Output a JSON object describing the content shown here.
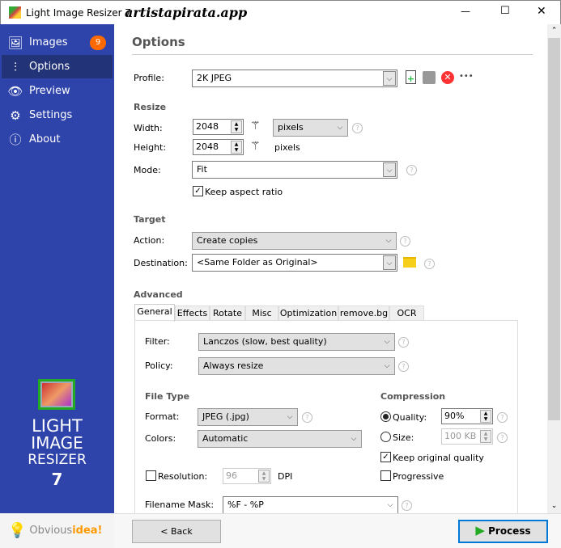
{
  "window": {
    "title": "Light Image Resizer 7",
    "watermark": "artistapirata.app",
    "minimize": "—",
    "maximize": "☐",
    "close": "✕"
  },
  "sidebar": {
    "items": [
      {
        "label": "Images",
        "icon": "images-icon",
        "badge": "9"
      },
      {
        "label": "Options",
        "icon": "sliders-icon"
      },
      {
        "label": "Preview",
        "icon": "eye-icon"
      },
      {
        "label": "Settings",
        "icon": "gear-icon"
      },
      {
        "label": "About",
        "icon": "info-icon"
      }
    ],
    "logo": {
      "line1": "LIGHT",
      "line2": "IMAGE",
      "line3": "RESIZER",
      "line4": "7"
    },
    "brand": {
      "part1": "Obvious",
      "part2": "idea!"
    }
  },
  "main": {
    "title": "Options",
    "profile": {
      "label": "Profile:",
      "value": "2K JPEG",
      "more": "•••"
    },
    "resize": {
      "heading": "Resize",
      "width_label": "Width:",
      "width": "2048",
      "height_label": "Height:",
      "height": "2048",
      "unit": "pixels",
      "height_unit": "pixels",
      "mode_label": "Mode:",
      "mode": "Fit",
      "keep_aspect": "Keep aspect ratio"
    },
    "target": {
      "heading": "Target",
      "action_label": "Action:",
      "action": "Create copies",
      "destination_label": "Destination:",
      "destination": "<Same Folder as Original>"
    },
    "advanced": {
      "heading": "Advanced",
      "tabs": [
        "General",
        "Effects",
        "Rotate",
        "Misc",
        "Optimization",
        "remove.bg",
        "OCR"
      ],
      "filter_label": "Filter:",
      "filter": "Lanczos  (slow, best quality)",
      "policy_label": "Policy:",
      "policy": "Always resize",
      "filetype_heading": "File Type",
      "format_label": "Format:",
      "format": "JPEG (.jpg)",
      "colors_label": "Colors:",
      "colors": "Automatic",
      "resolution_label": "Resolution:",
      "resolution": "96",
      "dpi": "DPI",
      "compression_heading": "Compression",
      "quality_label": "Quality:",
      "quality": "90%",
      "size_label": "Size:",
      "size": "100 KB",
      "keep_quality": "Keep original quality",
      "progressive": "Progressive",
      "mask_label": "Filename Mask:",
      "mask": "%F - %P"
    }
  },
  "footer": {
    "back": "< Back",
    "process": "Process"
  }
}
